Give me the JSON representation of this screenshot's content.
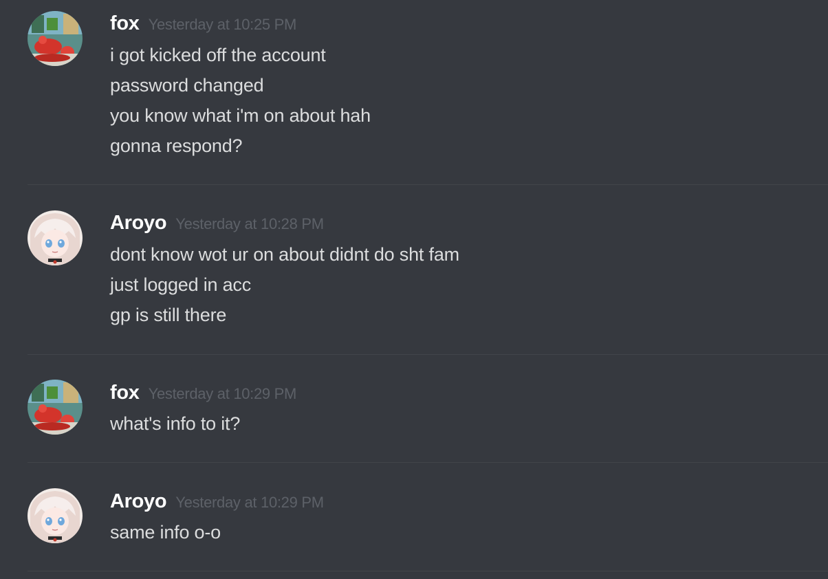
{
  "messages": [
    {
      "author": "fox",
      "avatar_icon": "fox-avatar-icon",
      "timestamp": "Yesterday at 10:25 PM",
      "lines": [
        "i got kicked off the account",
        "password changed",
        "you know what i'm on about hah",
        "gonna respond?"
      ]
    },
    {
      "author": "Aroyo",
      "avatar_icon": "aroyo-avatar-icon",
      "timestamp": "Yesterday at 10:28 PM",
      "lines": [
        "dont know wot ur on about didnt do sht fam",
        "just logged in acc",
        "gp is still there"
      ]
    },
    {
      "author": "fox",
      "avatar_icon": "fox-avatar-icon",
      "timestamp": "Yesterday at 10:29 PM",
      "lines": [
        "what's info to it?"
      ]
    },
    {
      "author": "Aroyo",
      "avatar_icon": "aroyo-avatar-icon",
      "timestamp": "Yesterday at 10:29 PM",
      "lines": [
        "same info o-o"
      ]
    }
  ],
  "colors": {
    "background": "#36393f",
    "username": "#ffffff",
    "timestamp": "#5d6168",
    "message_text": "#dcddde",
    "divider": "#42454a"
  }
}
